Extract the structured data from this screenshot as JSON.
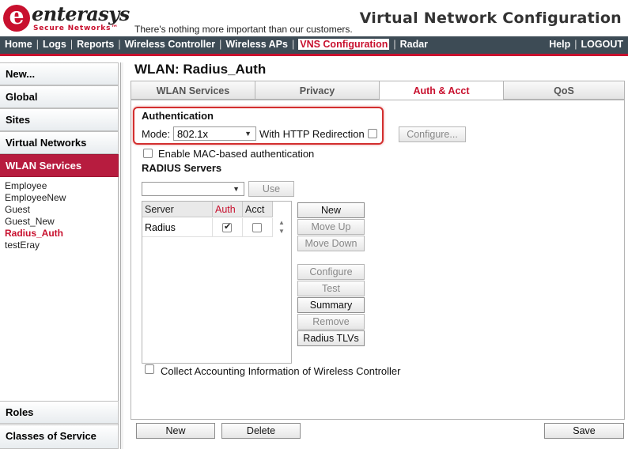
{
  "header": {
    "logo_word": "enterasys",
    "logo_sub": "Secure Networks™",
    "tagline": "There's nothing more important than our customers.",
    "app_title": "Virtual Network Configuration"
  },
  "nav": {
    "items": [
      "Home",
      "Logs",
      "Reports",
      "Wireless Controller",
      "Wireless APs",
      "VNS Configuration",
      "Radar"
    ],
    "right": [
      "Help",
      "LOGOUT"
    ]
  },
  "sidebar": {
    "sections": [
      "New...",
      "Global",
      "Sites",
      "Virtual Networks",
      "WLAN Services"
    ],
    "items": [
      "Employee",
      "EmployeeNew",
      "Guest",
      "Guest_New",
      "Radius_Auth",
      "testEray"
    ],
    "bottom": [
      "Roles",
      "Classes of Service"
    ]
  },
  "page": {
    "title": "WLAN: Radius_Auth"
  },
  "tabs": [
    "WLAN Services",
    "Privacy",
    "Auth & Acct",
    "QoS"
  ],
  "auth": {
    "heading": "Authentication",
    "mode_label": "Mode:",
    "mode_value": "802.1x",
    "http_redirect_label": "With HTTP Redirection",
    "configure_label": "Configure...",
    "mac_auth_label": "Enable MAC-based authentication"
  },
  "radius": {
    "heading": "RADIUS Servers",
    "use_label": "Use",
    "columns": [
      "Server",
      "Auth",
      "Acct"
    ],
    "rows": [
      {
        "server": "Radius",
        "auth": true,
        "acct": false
      }
    ],
    "buttons": {
      "new": "New",
      "move_up": "Move Up",
      "move_down": "Move Down",
      "configure": "Configure",
      "test": "Test",
      "summary": "Summary",
      "remove": "Remove",
      "tlvs": "Radius TLVs"
    },
    "collect_label": "Collect Accounting Information of Wireless Controller"
  },
  "footer": {
    "new": "New",
    "delete": "Delete",
    "save": "Save"
  },
  "colors": {
    "brand": "#c8102e",
    "nav_bg": "#3d4b55",
    "highlight": "#d32f2f"
  }
}
